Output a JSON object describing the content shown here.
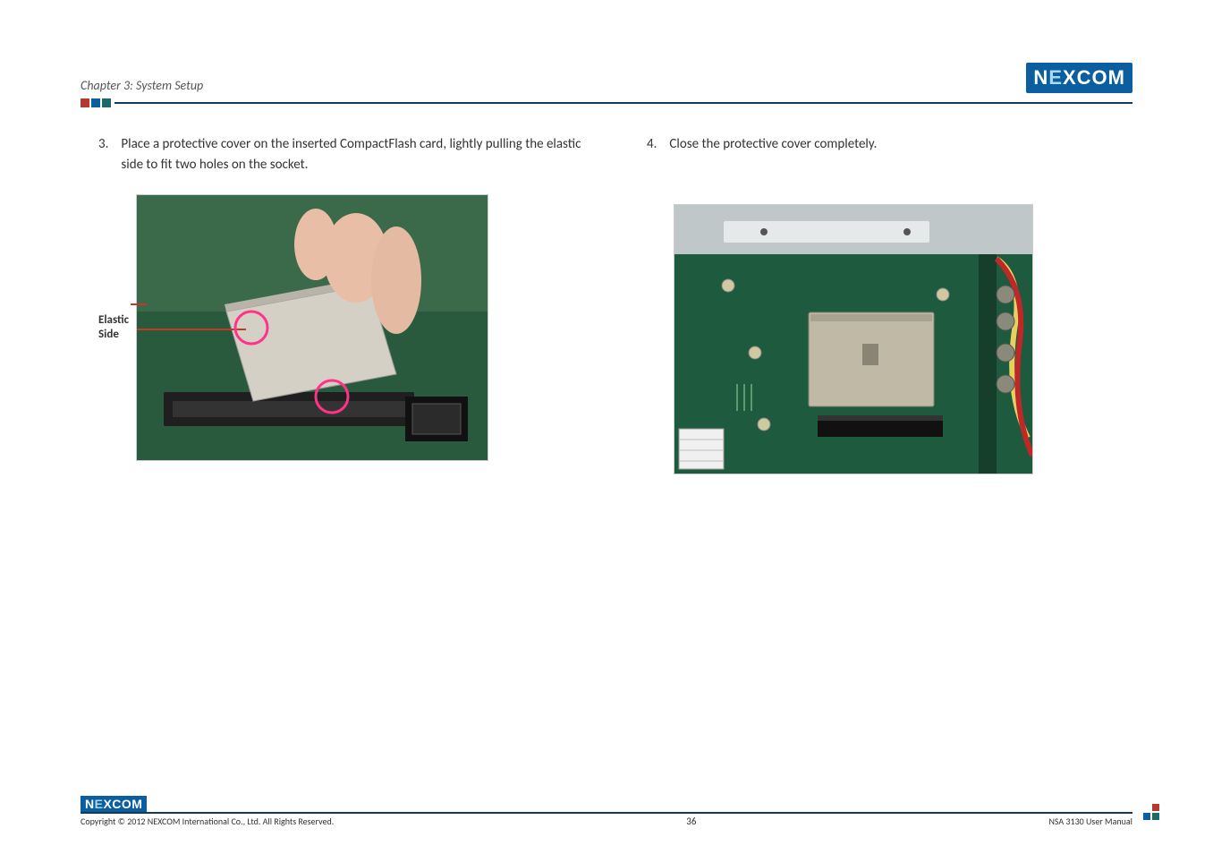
{
  "header": {
    "chapter_label": "Chapter 3: System Setup",
    "brand_top": "NEXCOM"
  },
  "left_step": {
    "number": "3.",
    "text": "Place a protective cover on the inserted CompactFlash card, lightly pulling the elastic side to fit two holes on the socket.",
    "annotation": "Elastic\nSide"
  },
  "right_step": {
    "number": "4.",
    "text": "Close the protective cover completely."
  },
  "footer": {
    "brand_bottom": "NEXCOM",
    "copyright": "Copyright © 2012 NEXCOM International Co., Ltd. All Rights Reserved.",
    "page": "36",
    "doc": "NSA 3130 User Manual"
  }
}
